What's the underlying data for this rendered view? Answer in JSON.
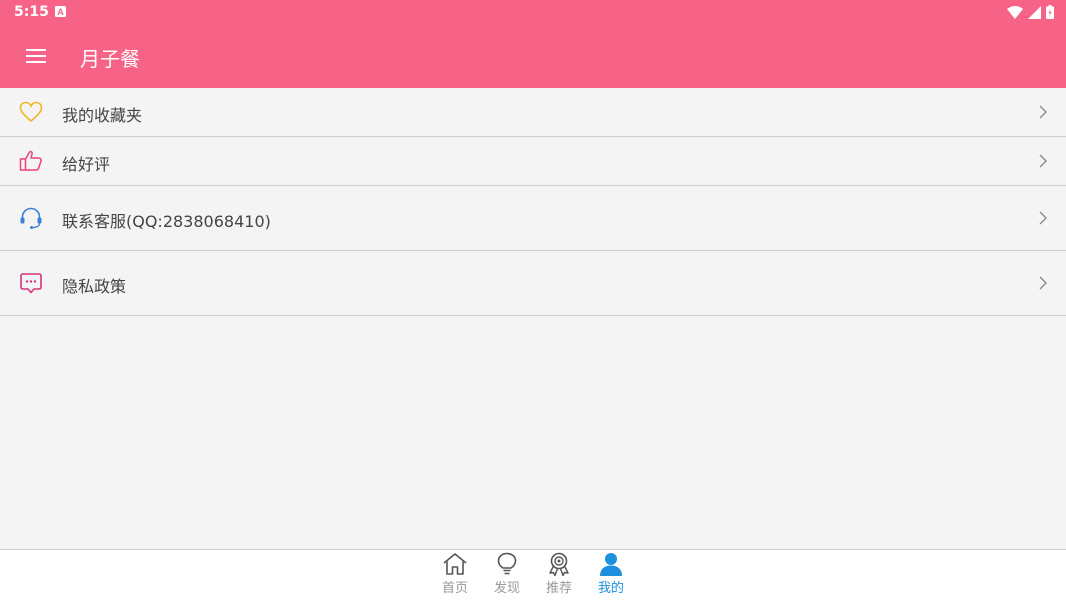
{
  "status": {
    "time": "5:15",
    "notification_glyph": "A"
  },
  "toolbar": {
    "title": "月子餐",
    "menu_icon": "menu-icon"
  },
  "menu": {
    "items": [
      {
        "label": "我的收藏夹",
        "icon": "heart-icon",
        "icon_color": "#f0b429"
      },
      {
        "label": "给好评",
        "icon": "thumbs-up-icon",
        "icon_color": "#e8457a"
      },
      {
        "label": "联系客服(QQ:2838068410)",
        "icon": "headset-icon",
        "icon_color": "#3b82d6"
      },
      {
        "label": "隐私政策",
        "icon": "chat-bubble-icon",
        "icon_color": "#d6357a"
      }
    ]
  },
  "bottom_nav": {
    "items": [
      {
        "label": "首页",
        "icon": "home-icon",
        "active": false
      },
      {
        "label": "发现",
        "icon": "lightbulb-icon",
        "active": false
      },
      {
        "label": "推荐",
        "icon": "award-icon",
        "active": false
      },
      {
        "label": "我的",
        "icon": "user-icon",
        "active": true
      }
    ]
  },
  "colors": {
    "accent": "#f76386",
    "active_tab": "#1e90e0",
    "background": "#f4f4f4"
  }
}
